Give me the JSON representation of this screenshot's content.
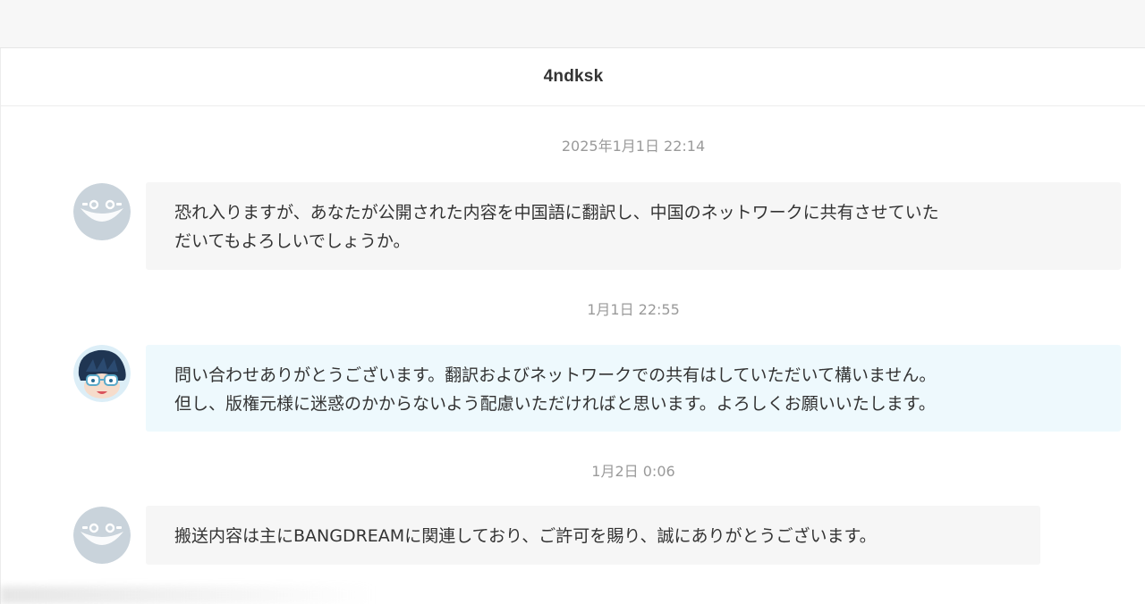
{
  "chat": {
    "title": "4ndksk"
  },
  "messages": [
    {
      "timestamp": "2025年1月1日 22:14",
      "sender": "other",
      "avatar_icon": "noimage-avatar-icon",
      "text_lines": [
        "恐れ入りますが、あなたが公開された内容を中国語に翻訳し、中国のネットワークに共有させていた",
        "だいてもよろしいでしょうか。"
      ]
    },
    {
      "timestamp": "1月1日 22:55",
      "sender": "me",
      "avatar_icon": "user-avatar-icon",
      "text_lines": [
        "問い合わせありがとうございます。翻訳およびネットワークでの共有はしていただいて構いません。",
        "但し、版権元様に迷惑のかからないよう配慮いただければと思います。よろしくお願いいたします。"
      ]
    },
    {
      "timestamp": "1月2日 0:06",
      "sender": "other",
      "avatar_icon": "noimage-avatar-icon",
      "text_lines": [
        "搬送内容は主にBANGDREAMに関連しており、ご許可を賜り、誠にありがとうございます。"
      ]
    }
  ],
  "colors": {
    "received_bubble": "#f6f6f6",
    "sent_bubble": "#eef9fd",
    "timestamp_text": "#9a9a9a",
    "body_text": "#333333"
  }
}
